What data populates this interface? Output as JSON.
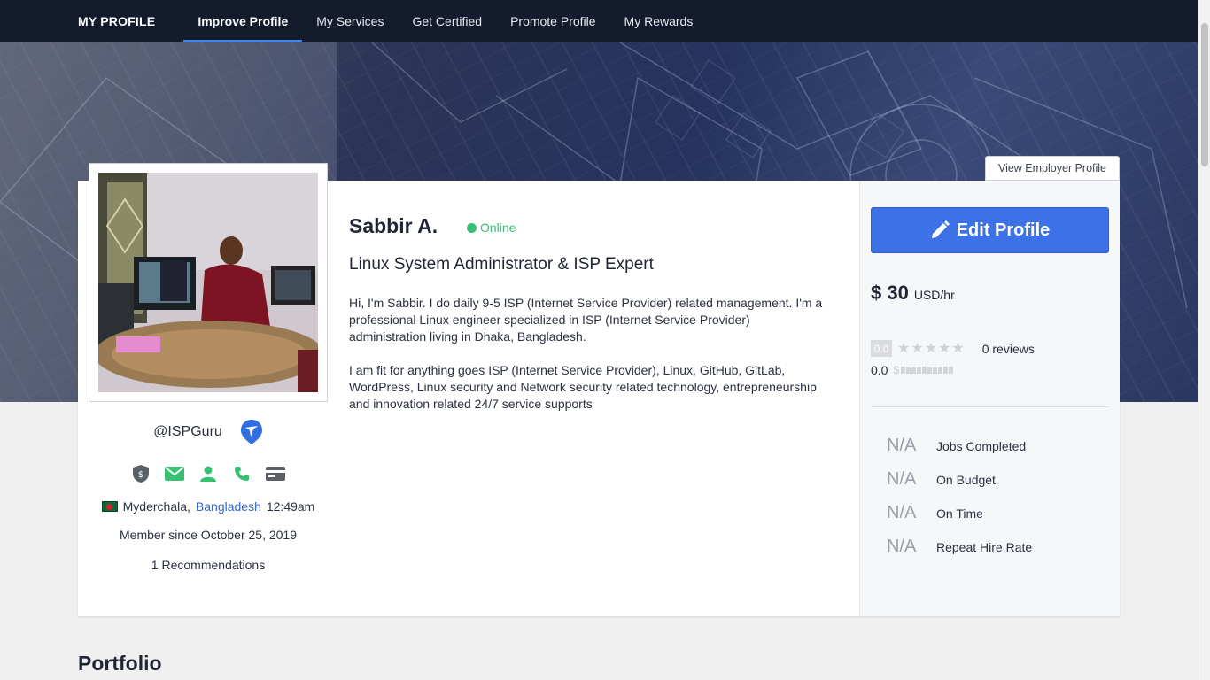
{
  "nav": {
    "brand": "MY PROFILE",
    "items": [
      {
        "label": "Improve Profile",
        "active": true
      },
      {
        "label": "My Services",
        "active": false
      },
      {
        "label": "Get Certified",
        "active": false
      },
      {
        "label": "Promote Profile",
        "active": false
      },
      {
        "label": "My Rewards",
        "active": false
      }
    ]
  },
  "banner": {
    "employer_button": "View Employer Profile"
  },
  "profile": {
    "username": "@ISPGuru",
    "location_city": "Myderchala,",
    "location_country": "Bangladesh",
    "local_time": "12:49am",
    "member_since": "Member since October 25, 2019",
    "recommendations": "1 Recommendations",
    "verifications": [
      "payment-verified-icon",
      "email-verified-icon",
      "identity-verified-icon",
      "phone-verified-icon",
      "card-verified-icon"
    ]
  },
  "main": {
    "name": "Sabbir A.",
    "status": "Online",
    "headline": "Linux System Administrator & ISP Expert",
    "about": [
      "Hi, I'm Sabbir. I do daily 9-5 ISP (Internet Service Provider) related management. I'm a professional Linux engineer specialized in ISP (Internet Service Provider) administration living in Dhaka, Bangladesh.",
      "I am fit for anything goes ISP (Internet Service Provider), Linux, GitHub, GitLab, WordPress, Linux security and Network security related technology, entrepreneurship and innovation related 24/7 service supports"
    ]
  },
  "sidebar": {
    "edit_label": "Edit Profile",
    "rate_amount": "$ 30",
    "rate_unit": "USD/hr",
    "score": "0.0",
    "star_rating": 0,
    "reviews": "0 reviews",
    "earnings_score": "0.0",
    "earnings_symbol": "$",
    "stats": [
      {
        "value": "N/A",
        "label": "Jobs Completed"
      },
      {
        "value": "N/A",
        "label": "On Budget"
      },
      {
        "value": "N/A",
        "label": "On Time"
      },
      {
        "value": "N/A",
        "label": "Repeat Hire Rate"
      }
    ]
  },
  "sections": {
    "portfolio": "Portfolio"
  },
  "colors": {
    "nav_bg": "#141b2d",
    "accent": "#3d72e6",
    "online": "#38c172",
    "verify": "#38c172",
    "link": "#2f66d0"
  }
}
